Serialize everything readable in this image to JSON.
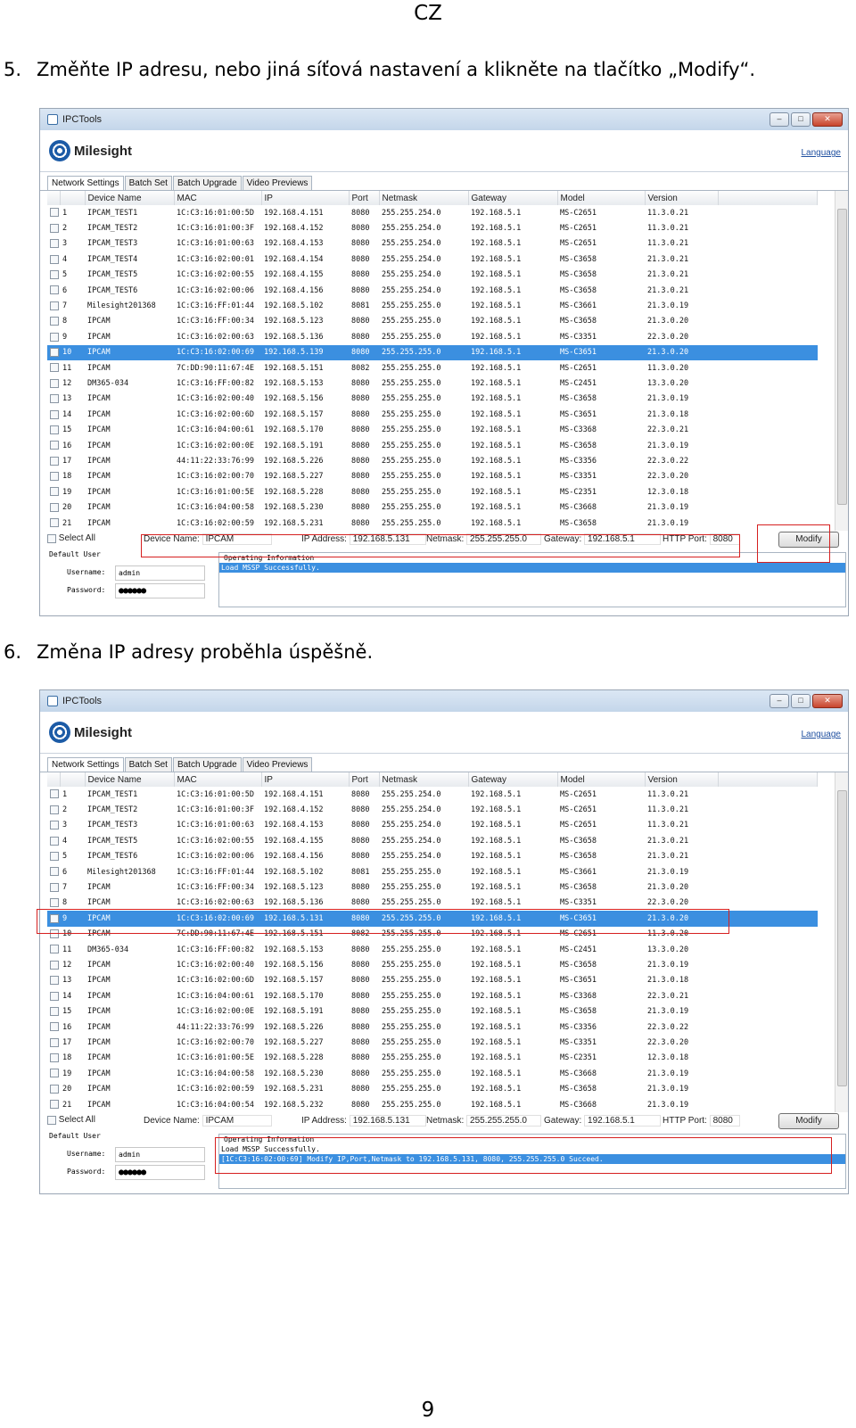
{
  "header": "CZ",
  "steps": [
    {
      "number": "5.",
      "text": "Změňte IP adresu, nebo jiná síťová nastavení a klikněte na tlačítko „Modify“."
    },
    {
      "number": "6.",
      "text": "Změna IP adresy proběhla úspěšně."
    }
  ],
  "page_number": "9",
  "app": {
    "title": "IPCTools",
    "brand": "Milesight",
    "language_link": "Language",
    "tabs": [
      "Network Settings",
      "Batch Set",
      "Batch Upgrade",
      "Video Previews"
    ],
    "columns": [
      "Device Name",
      "MAC",
      "IP",
      "Port",
      "Netmask",
      "Gateway",
      "Model",
      "Version"
    ],
    "select_all": "Select All",
    "labels": {
      "device_name": "Device Name:",
      "ip_address": "IP Address:",
      "netmask": "Netmask:",
      "gateway": "Gateway:",
      "http_port": "HTTP Port:",
      "modify": "Modify",
      "default_user": "Default User",
      "username": "Username:",
      "password": "Password:",
      "operating_information": "Operating Information"
    },
    "form": {
      "device_name": "IPCAM",
      "ip_address": "192.168.5.131",
      "netmask": "255.255.255.0",
      "gateway": "192.168.5.1",
      "http_port": "8080",
      "username": "admin",
      "password": "●●●●●●"
    }
  },
  "screens": [
    {
      "selected_row": 10,
      "rows": [
        [
          "1",
          "IPCAM_TEST1",
          "1C:C3:16:01:00:5D",
          "192.168.4.151",
          "8080",
          "255.255.254.0",
          "192.168.5.1",
          "MS-C2651",
          "11.3.0.21"
        ],
        [
          "2",
          "IPCAM_TEST2",
          "1C:C3:16:01:00:3F",
          "192.168.4.152",
          "8080",
          "255.255.254.0",
          "192.168.5.1",
          "MS-C2651",
          "11.3.0.21"
        ],
        [
          "3",
          "IPCAM_TEST3",
          "1C:C3:16:01:00:63",
          "192.168.4.153",
          "8080",
          "255.255.254.0",
          "192.168.5.1",
          "MS-C2651",
          "11.3.0.21"
        ],
        [
          "4",
          "IPCAM_TEST4",
          "1C:C3:16:02:00:01",
          "192.168.4.154",
          "8080",
          "255.255.254.0",
          "192.168.5.1",
          "MS-C3658",
          "21.3.0.21"
        ],
        [
          "5",
          "IPCAM_TEST5",
          "1C:C3:16:02:00:55",
          "192.168.4.155",
          "8080",
          "255.255.254.0",
          "192.168.5.1",
          "MS-C3658",
          "21.3.0.21"
        ],
        [
          "6",
          "IPCAM_TEST6",
          "1C:C3:16:02:00:06",
          "192.168.4.156",
          "8080",
          "255.255.254.0",
          "192.168.5.1",
          "MS-C3658",
          "21.3.0.21"
        ],
        [
          "7",
          "Milesight201368",
          "1C:C3:16:FF:01:44",
          "192.168.5.102",
          "8081",
          "255.255.255.0",
          "192.168.5.1",
          "MS-C3661",
          "21.3.0.19"
        ],
        [
          "8",
          "IPCAM",
          "1C:C3:16:FF:00:34",
          "192.168.5.123",
          "8080",
          "255.255.255.0",
          "192.168.5.1",
          "MS-C3658",
          "21.3.0.20"
        ],
        [
          "9",
          "IPCAM",
          "1C:C3:16:02:00:63",
          "192.168.5.136",
          "8080",
          "255.255.255.0",
          "192.168.5.1",
          "MS-C3351",
          "22.3.0.20"
        ],
        [
          "10",
          "IPCAM",
          "1C:C3:16:02:00:69",
          "192.168.5.139",
          "8080",
          "255.255.255.0",
          "192.168.5.1",
          "MS-C3651",
          "21.3.0.20"
        ],
        [
          "11",
          "IPCAM",
          "7C:DD:90:11:67:4E",
          "192.168.5.151",
          "8082",
          "255.255.255.0",
          "192.168.5.1",
          "MS-C2651",
          "11.3.0.20"
        ],
        [
          "12",
          "DM365-034",
          "1C:C3:16:FF:00:82",
          "192.168.5.153",
          "8080",
          "255.255.255.0",
          "192.168.5.1",
          "MS-C2451",
          "13.3.0.20"
        ],
        [
          "13",
          "IPCAM",
          "1C:C3:16:02:00:40",
          "192.168.5.156",
          "8080",
          "255.255.255.0",
          "192.168.5.1",
          "MS-C3658",
          "21.3.0.19"
        ],
        [
          "14",
          "IPCAM",
          "1C:C3:16:02:00:6D",
          "192.168.5.157",
          "8080",
          "255.255.255.0",
          "192.168.5.1",
          "MS-C3651",
          "21.3.0.18"
        ],
        [
          "15",
          "IPCAM",
          "1C:C3:16:04:00:61",
          "192.168.5.170",
          "8080",
          "255.255.255.0",
          "192.168.5.1",
          "MS-C3368",
          "22.3.0.21"
        ],
        [
          "16",
          "IPCAM",
          "1C:C3:16:02:00:0E",
          "192.168.5.191",
          "8080",
          "255.255.255.0",
          "192.168.5.1",
          "MS-C3658",
          "21.3.0.19"
        ],
        [
          "17",
          "IPCAM",
          "44:11:22:33:76:99",
          "192.168.5.226",
          "8080",
          "255.255.255.0",
          "192.168.5.1",
          "MS-C3356",
          "22.3.0.22"
        ],
        [
          "18",
          "IPCAM",
          "1C:C3:16:02:00:70",
          "192.168.5.227",
          "8080",
          "255.255.255.0",
          "192.168.5.1",
          "MS-C3351",
          "22.3.0.20"
        ],
        [
          "19",
          "IPCAM",
          "1C:C3:16:01:00:5E",
          "192.168.5.228",
          "8080",
          "255.255.255.0",
          "192.168.5.1",
          "MS-C2351",
          "12.3.0.18"
        ],
        [
          "20",
          "IPCAM",
          "1C:C3:16:04:00:58",
          "192.168.5.230",
          "8080",
          "255.255.255.0",
          "192.168.5.1",
          "MS-C3668",
          "21.3.0.19"
        ],
        [
          "21",
          "IPCAM",
          "1C:C3:16:02:00:59",
          "192.168.5.231",
          "8080",
          "255.255.255.0",
          "192.168.5.1",
          "MS-C3658",
          "21.3.0.19"
        ]
      ],
      "log": [
        "Load MSSP Successfully."
      ]
    },
    {
      "selected_row": 9,
      "rows": [
        [
          "1",
          "IPCAM_TEST1",
          "1C:C3:16:01:00:5D",
          "192.168.4.151",
          "8080",
          "255.255.254.0",
          "192.168.5.1",
          "MS-C2651",
          "11.3.0.21"
        ],
        [
          "2",
          "IPCAM_TEST2",
          "1C:C3:16:01:00:3F",
          "192.168.4.152",
          "8080",
          "255.255.254.0",
          "192.168.5.1",
          "MS-C2651",
          "11.3.0.21"
        ],
        [
          "3",
          "IPCAM_TEST3",
          "1C:C3:16:01:00:63",
          "192.168.4.153",
          "8080",
          "255.255.254.0",
          "192.168.5.1",
          "MS-C2651",
          "11.3.0.21"
        ],
        [
          "4",
          "IPCAM_TEST5",
          "1C:C3:16:02:00:55",
          "192.168.4.155",
          "8080",
          "255.255.254.0",
          "192.168.5.1",
          "MS-C3658",
          "21.3.0.21"
        ],
        [
          "5",
          "IPCAM_TEST6",
          "1C:C3:16:02:00:06",
          "192.168.4.156",
          "8080",
          "255.255.254.0",
          "192.168.5.1",
          "MS-C3658",
          "21.3.0.21"
        ],
        [
          "6",
          "Milesight201368",
          "1C:C3:16:FF:01:44",
          "192.168.5.102",
          "8081",
          "255.255.255.0",
          "192.168.5.1",
          "MS-C3661",
          "21.3.0.19"
        ],
        [
          "7",
          "IPCAM",
          "1C:C3:16:FF:00:34",
          "192.168.5.123",
          "8080",
          "255.255.255.0",
          "192.168.5.1",
          "MS-C3658",
          "21.3.0.20"
        ],
        [
          "8",
          "IPCAM",
          "1C:C3:16:02:00:63",
          "192.168.5.136",
          "8080",
          "255.255.255.0",
          "192.168.5.1",
          "MS-C3351",
          "22.3.0.20"
        ],
        [
          "9",
          "IPCAM",
          "1C:C3:16:02:00:69",
          "192.168.5.131",
          "8080",
          "255.255.255.0",
          "192.168.5.1",
          "MS-C3651",
          "21.3.0.20"
        ],
        [
          "10",
          "IPCAM",
          "7C:DD:90:11:67:4E",
          "192.168.5.151",
          "8082",
          "255.255.255.0",
          "192.168.5.1",
          "MS-C2651",
          "11.3.0.20"
        ],
        [
          "11",
          "DM365-034",
          "1C:C3:16:FF:00:82",
          "192.168.5.153",
          "8080",
          "255.255.255.0",
          "192.168.5.1",
          "MS-C2451",
          "13.3.0.20"
        ],
        [
          "12",
          "IPCAM",
          "1C:C3:16:02:00:40",
          "192.168.5.156",
          "8080",
          "255.255.255.0",
          "192.168.5.1",
          "MS-C3658",
          "21.3.0.19"
        ],
        [
          "13",
          "IPCAM",
          "1C:C3:16:02:00:6D",
          "192.168.5.157",
          "8080",
          "255.255.255.0",
          "192.168.5.1",
          "MS-C3651",
          "21.3.0.18"
        ],
        [
          "14",
          "IPCAM",
          "1C:C3:16:04:00:61",
          "192.168.5.170",
          "8080",
          "255.255.255.0",
          "192.168.5.1",
          "MS-C3368",
          "22.3.0.21"
        ],
        [
          "15",
          "IPCAM",
          "1C:C3:16:02:00:0E",
          "192.168.5.191",
          "8080",
          "255.255.255.0",
          "192.168.5.1",
          "MS-C3658",
          "21.3.0.19"
        ],
        [
          "16",
          "IPCAM",
          "44:11:22:33:76:99",
          "192.168.5.226",
          "8080",
          "255.255.255.0",
          "192.168.5.1",
          "MS-C3356",
          "22.3.0.22"
        ],
        [
          "17",
          "IPCAM",
          "1C:C3:16:02:00:70",
          "192.168.5.227",
          "8080",
          "255.255.255.0",
          "192.168.5.1",
          "MS-C3351",
          "22.3.0.20"
        ],
        [
          "18",
          "IPCAM",
          "1C:C3:16:01:00:5E",
          "192.168.5.228",
          "8080",
          "255.255.255.0",
          "192.168.5.1",
          "MS-C2351",
          "12.3.0.18"
        ],
        [
          "19",
          "IPCAM",
          "1C:C3:16:04:00:58",
          "192.168.5.230",
          "8080",
          "255.255.255.0",
          "192.168.5.1",
          "MS-C3668",
          "21.3.0.19"
        ],
        [
          "20",
          "IPCAM",
          "1C:C3:16:02:00:59",
          "192.168.5.231",
          "8080",
          "255.255.255.0",
          "192.168.5.1",
          "MS-C3658",
          "21.3.0.19"
        ],
        [
          "21",
          "IPCAM",
          "1C:C3:16:04:00:54",
          "192.168.5.232",
          "8080",
          "255.255.255.0",
          "192.168.5.1",
          "MS-C3668",
          "21.3.0.19"
        ]
      ],
      "log": [
        "Load MSSP Successfully.",
        "[1C:C3:16:02:00:69] Modify IP,Port,Netmask to 192.168.5.131, 8080, 255.255.255.0 Succeed."
      ]
    }
  ]
}
